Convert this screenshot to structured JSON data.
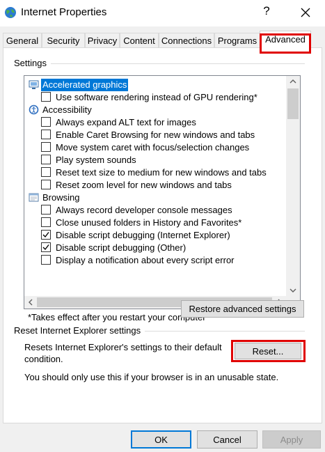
{
  "window": {
    "title": "Internet Properties",
    "help_glyph": "?",
    "app_icon": "globe-icon",
    "close_icon": "close-icon"
  },
  "tabs": [
    {
      "label": "General"
    },
    {
      "label": "Security"
    },
    {
      "label": "Privacy"
    },
    {
      "label": "Content"
    },
    {
      "label": "Connections"
    },
    {
      "label": "Programs"
    },
    {
      "label": "Advanced"
    }
  ],
  "active_tab": "Advanced",
  "settings": {
    "group_title": "Settings",
    "items": [
      {
        "type": "category",
        "label": "Accelerated graphics",
        "icon": "monitor-icon",
        "selected": true
      },
      {
        "type": "option",
        "label": "Use software rendering instead of GPU rendering*",
        "checked": false
      },
      {
        "type": "category",
        "label": "Accessibility",
        "icon": "accessibility-icon",
        "selected": false
      },
      {
        "type": "option",
        "label": "Always expand ALT text for images",
        "checked": false
      },
      {
        "type": "option",
        "label": "Enable Caret Browsing for new windows and tabs",
        "checked": false
      },
      {
        "type": "option",
        "label": "Move system caret with focus/selection changes",
        "checked": false
      },
      {
        "type": "option",
        "label": "Play system sounds",
        "checked": false
      },
      {
        "type": "option",
        "label": "Reset text size to medium for new windows and tabs",
        "checked": false
      },
      {
        "type": "option",
        "label": "Reset zoom level for new windows and tabs",
        "checked": false
      },
      {
        "type": "category",
        "label": "Browsing",
        "icon": "page-icon",
        "selected": false
      },
      {
        "type": "option",
        "label": "Always record developer console messages",
        "checked": false
      },
      {
        "type": "option",
        "label": "Close unused folders in History and Favorites*",
        "checked": false
      },
      {
        "type": "option",
        "label": "Disable script debugging (Internet Explorer)",
        "checked": true
      },
      {
        "type": "option",
        "label": "Disable script debugging (Other)",
        "checked": true
      },
      {
        "type": "option",
        "label": "Display a notification about every script error",
        "checked": false
      }
    ],
    "footnote": "*Takes effect after you restart your computer",
    "restore_label": "Restore advanced settings"
  },
  "reset": {
    "group_title": "Reset Internet Explorer settings",
    "description": "Resets Internet Explorer's settings to their default condition.",
    "button_label": "Reset...",
    "warning": "You should only use this if your browser is in an unusable state."
  },
  "footer": {
    "ok_label": "OK",
    "cancel_label": "Cancel",
    "apply_label": "Apply"
  },
  "colors": {
    "highlight_border": "#e00000",
    "selection": "#0078d7"
  }
}
